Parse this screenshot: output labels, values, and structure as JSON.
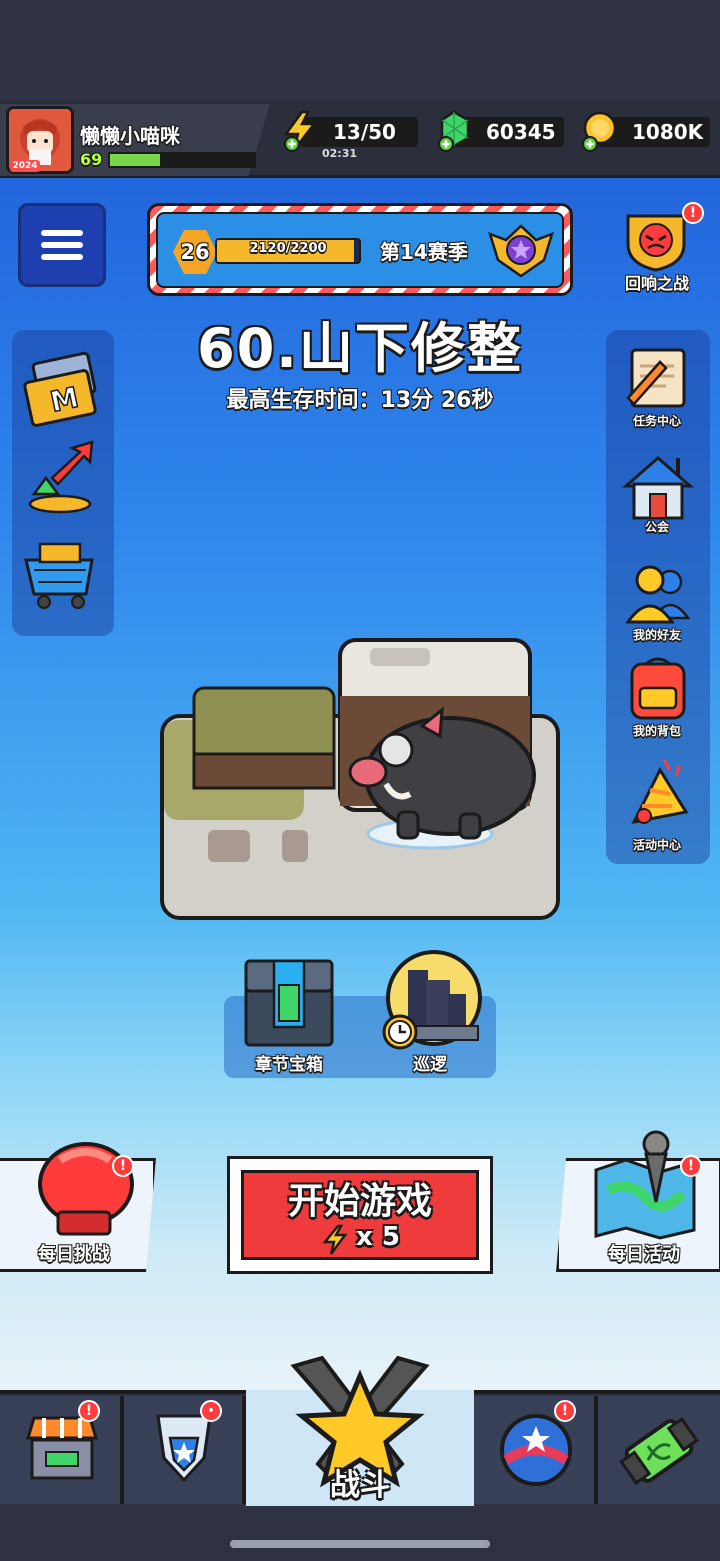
{
  "player": {
    "name": "懒懒小喵咪",
    "level": "69",
    "xp_progress": 0.35,
    "avatar_badge": "2024"
  },
  "resources": {
    "energy": {
      "value": "13/50",
      "timer": "02:31",
      "icon": "lightning-icon"
    },
    "gems": {
      "value": "60345",
      "icon": "gem-icon"
    },
    "coins": {
      "value": "1080K",
      "icon": "coin-icon"
    }
  },
  "season": {
    "level": "26",
    "xp": "2120/2200",
    "xp_progress": 0.9636,
    "name": "第14赛季"
  },
  "stage": {
    "title": "60.山下修整",
    "best_time": "最高生存时间：13分 26秒"
  },
  "right_menu": {
    "echo_battle": "回响之战",
    "tasks": "任务中心",
    "guild": "公会",
    "friends": "我的好友",
    "backpack": "我的背包",
    "events": "活动中心"
  },
  "chest_panel": {
    "chapter_chest": "章节宝箱",
    "patrol": "巡逻"
  },
  "actions": {
    "daily_challenge": "每日挑战",
    "start_game": "开始游戏",
    "start_cost": "x 5",
    "daily_event": "每日活动"
  },
  "nav": {
    "battle": "战斗"
  },
  "colors": {
    "accent_red": "#ef3b3b",
    "brand_blue": "#2f86ec",
    "gold": "#f5b82a"
  }
}
